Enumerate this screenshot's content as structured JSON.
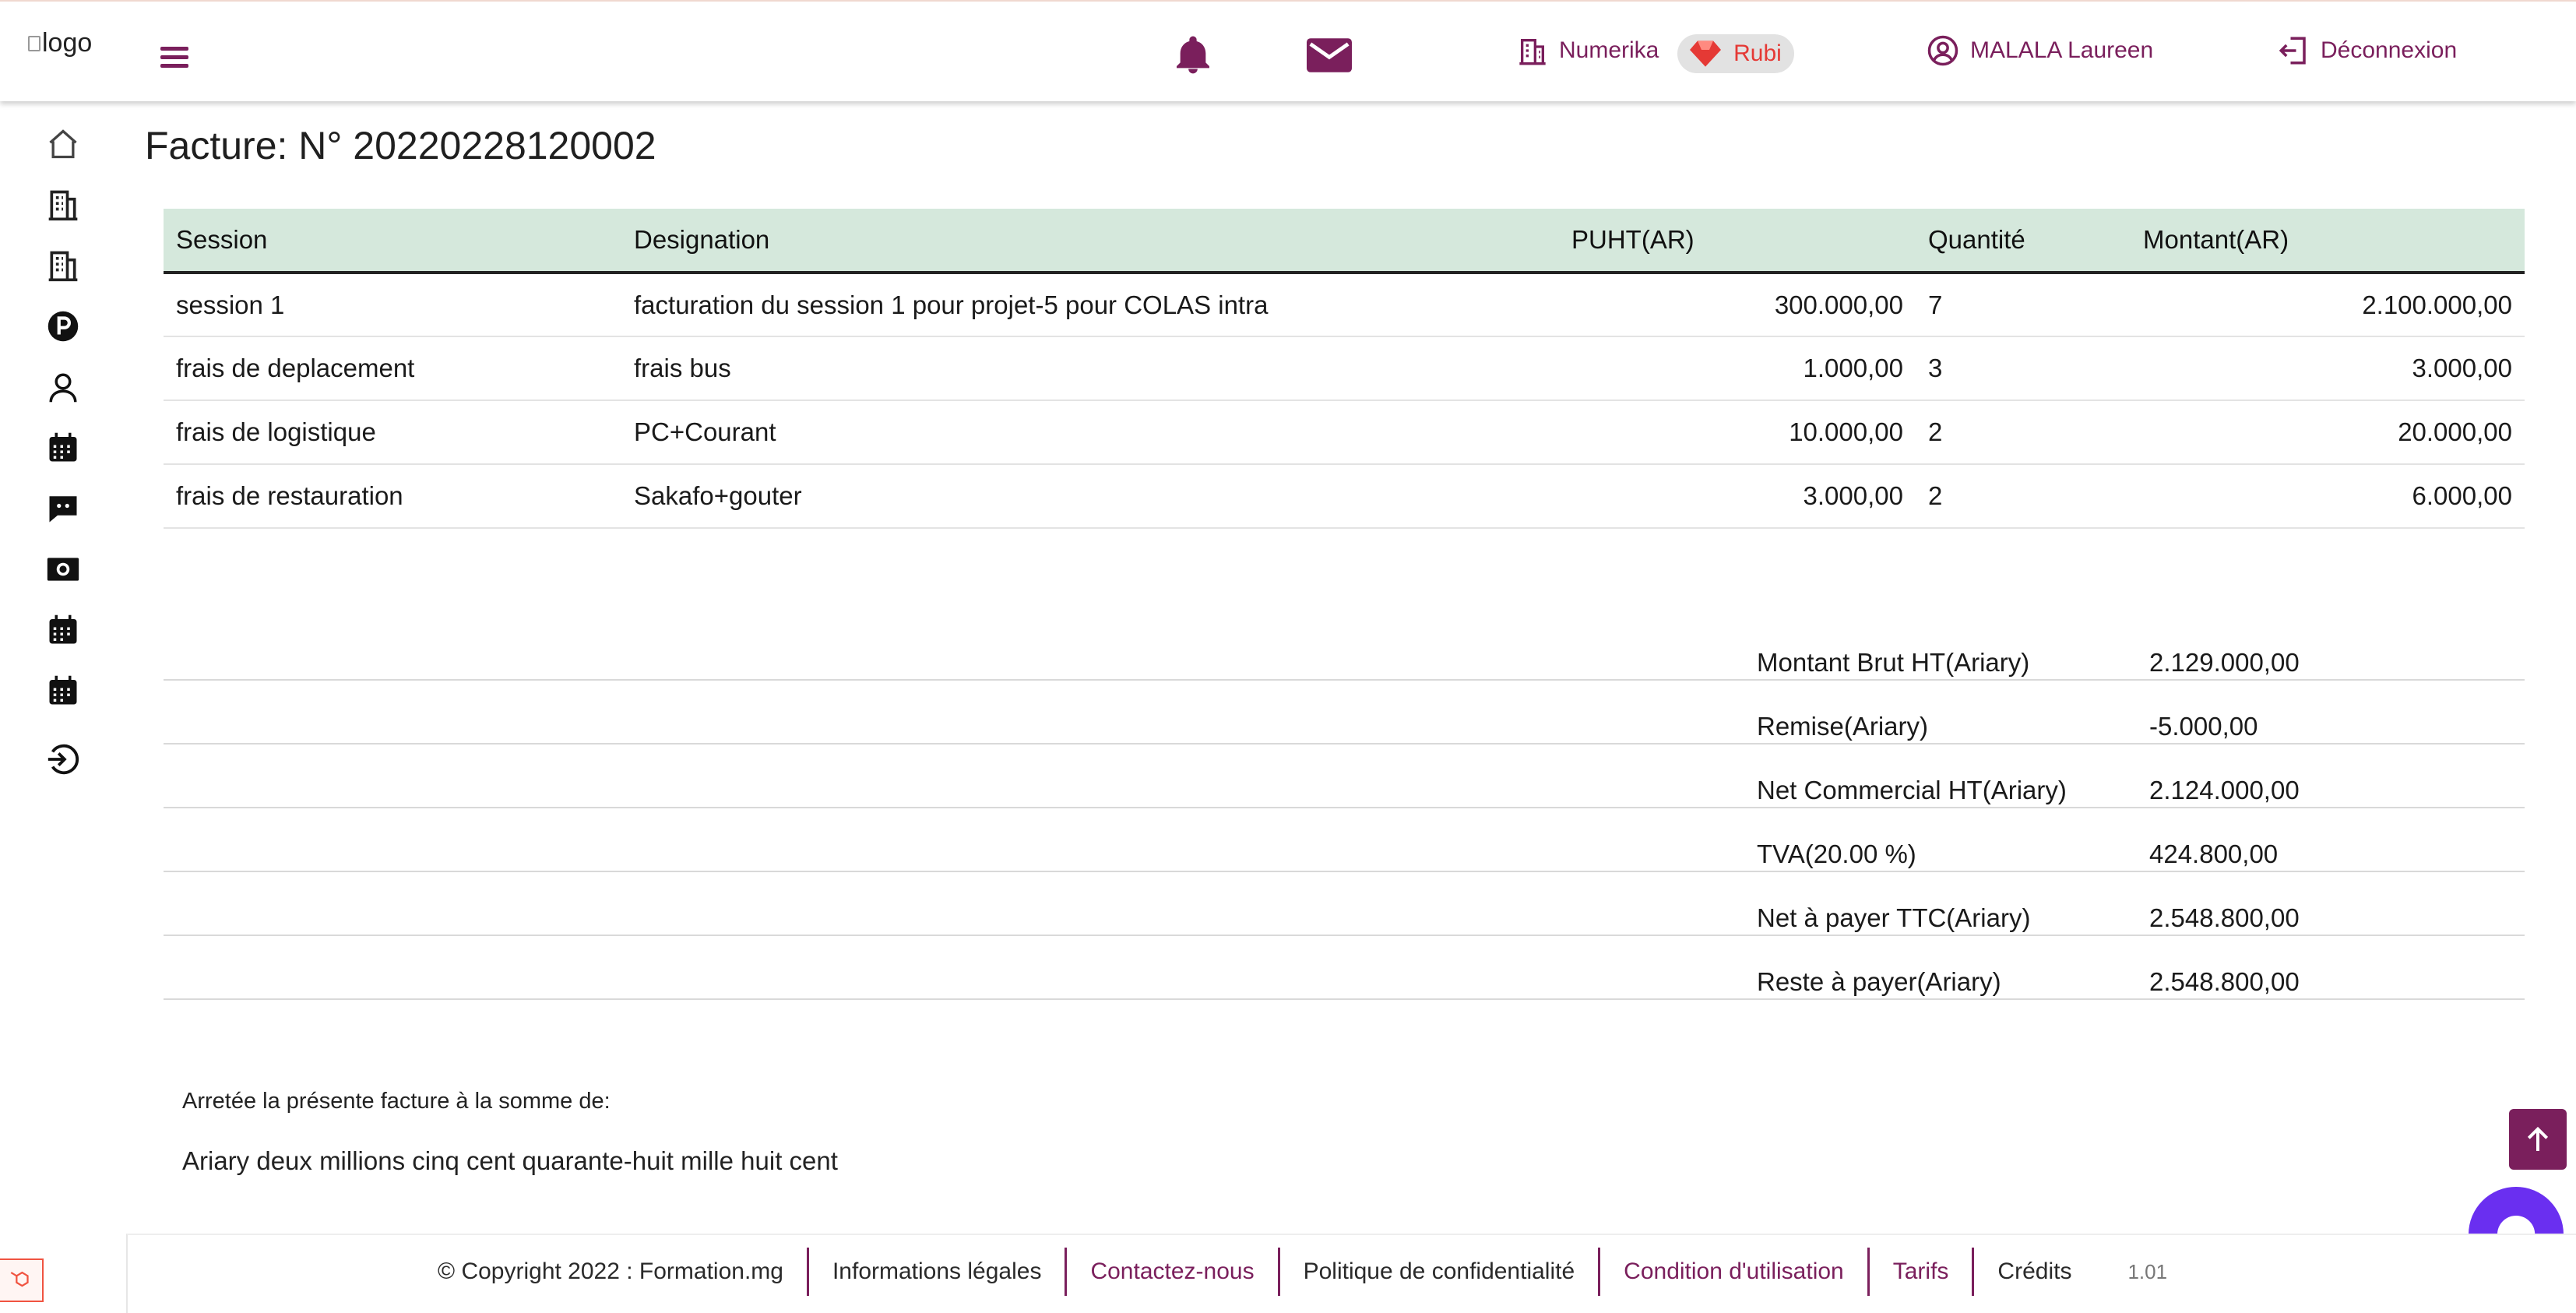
{
  "header": {
    "logo_alt": "logo",
    "company_link": "Numerika",
    "plan_badge": "Rubi",
    "user_name": "MALALA Laureen",
    "logout_label": "Déconnexion"
  },
  "sidebar": {
    "items": [
      {
        "icon": "home-icon"
      },
      {
        "icon": "building-icon"
      },
      {
        "icon": "building-icon"
      },
      {
        "icon": "parking-icon"
      },
      {
        "icon": "user-icon"
      },
      {
        "icon": "calendar-icon"
      },
      {
        "icon": "chat-icon"
      },
      {
        "icon": "money-icon"
      },
      {
        "icon": "calendar-icon"
      },
      {
        "icon": "calendar-icon"
      },
      {
        "icon": "logout-icon"
      }
    ]
  },
  "page": {
    "title": "Facture: N° 20220228120002"
  },
  "table": {
    "headers": [
      "Session",
      "Designation",
      "PUHT(AR)",
      "Quantité",
      "Montant(AR)"
    ],
    "rows": [
      [
        "session 1",
        "facturation du session 1 pour projet-5 pour COLAS intra",
        "300.000,00",
        "7",
        "2.100.000,00"
      ],
      [
        "frais de deplacement",
        "frais bus",
        "1.000,00",
        "3",
        "3.000,00"
      ],
      [
        "frais de logistique",
        "PC+Courant",
        "10.000,00",
        "2",
        "20.000,00"
      ],
      [
        "frais de restauration",
        "Sakafo+gouter",
        "3.000,00",
        "2",
        "6.000,00"
      ]
    ]
  },
  "totals": [
    {
      "label": "Montant Brut HT(Ariary)",
      "value": "2.129.000,00"
    },
    {
      "label": "Remise(Ariary)",
      "value": "-5.000,00"
    },
    {
      "label": "Net Commercial HT(Ariary)",
      "value": "2.124.000,00"
    },
    {
      "label": "TVA(20.00 %)",
      "value": "424.800,00"
    },
    {
      "label": "Net à payer TTC(Ariary)",
      "value": "2.548.800,00"
    },
    {
      "label": "Reste à payer(Ariary)",
      "value": "2.548.800,00"
    }
  ],
  "amount_words": {
    "label": "Arretée la présente facture à la somme de:",
    "text": "Ariary deux millions cinq cent quarante-huit mille huit cent"
  },
  "footer": {
    "copyright": "© Copyright 2022 : Formation.mg",
    "legal": "Informations légales",
    "contact": "Contactez-nous",
    "privacy": "Politique de confidentialité",
    "terms": "Condition d'utilisation",
    "pricing": "Tarifs",
    "credits": "Crédits",
    "version": "1.01"
  },
  "colors": {
    "brand": "#7a1f5c",
    "table_header_bg": "#d5e8dc",
    "badge_red": "#e53935",
    "chat": "#6a2ff0"
  }
}
